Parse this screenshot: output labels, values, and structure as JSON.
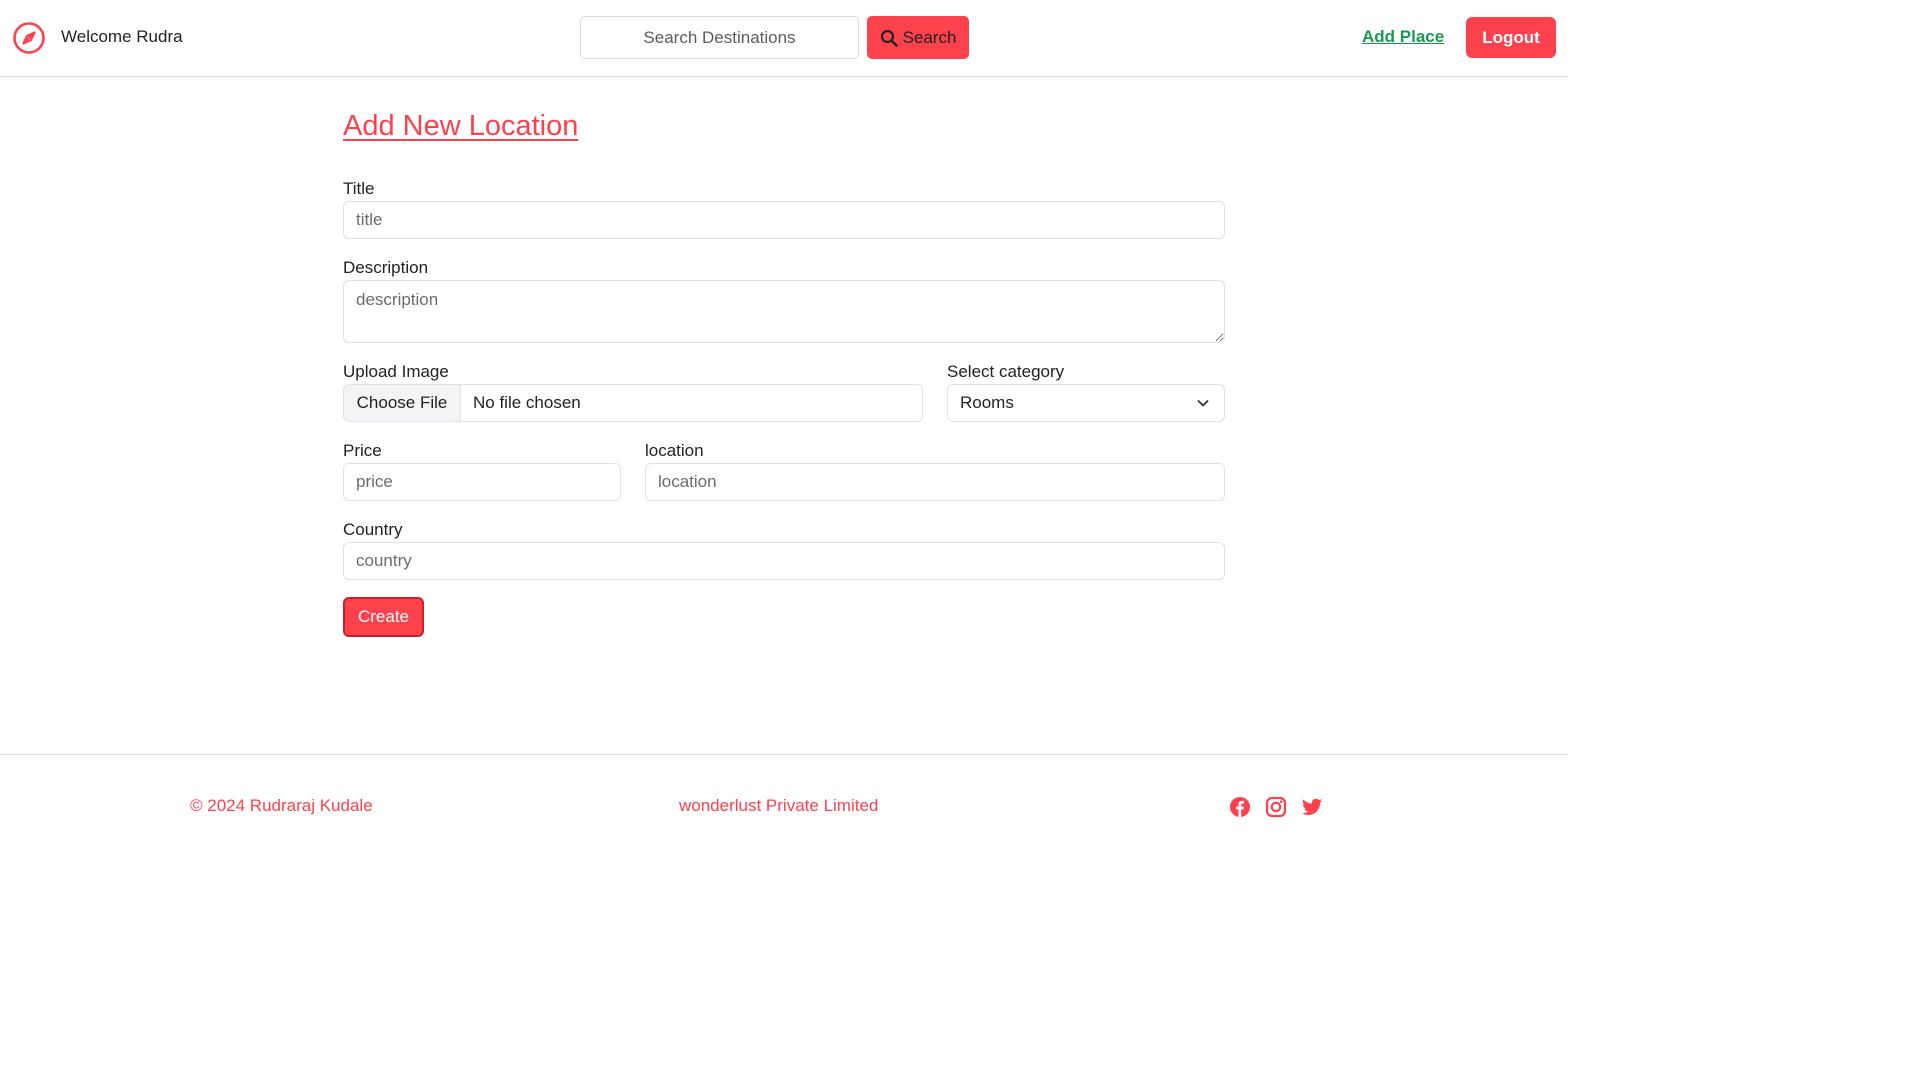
{
  "navbar": {
    "welcome_text": "Welcome Rudra",
    "brand_icon": "compass-icon",
    "search_placeholder": "Search Destinations",
    "search_button_label": "Search",
    "add_place_label": "Add Place",
    "logout_label": "Logout"
  },
  "form": {
    "heading": "Add New Location",
    "title_label": "Title",
    "title_placeholder": "title",
    "description_label": "Description",
    "description_placeholder": "description",
    "upload_label": "Upload Image",
    "choose_file_label": "Choose File",
    "file_status": "No file chosen",
    "category_label": "Select category",
    "category_selected": "Rooms",
    "price_label": "Price",
    "price_placeholder": "price",
    "location_label": "location",
    "location_placeholder": "location",
    "country_label": "Country",
    "country_placeholder": "country",
    "create_label": "Create"
  },
  "footer": {
    "copyright": "© 2024 Rudraraj Kudale",
    "company": "wonderlust Private Limited",
    "social_icons": [
      "facebook-icon",
      "instagram-icon",
      "twitter-icon"
    ]
  },
  "colors": {
    "accent": "#fe424d",
    "link_green": "#199a53"
  }
}
